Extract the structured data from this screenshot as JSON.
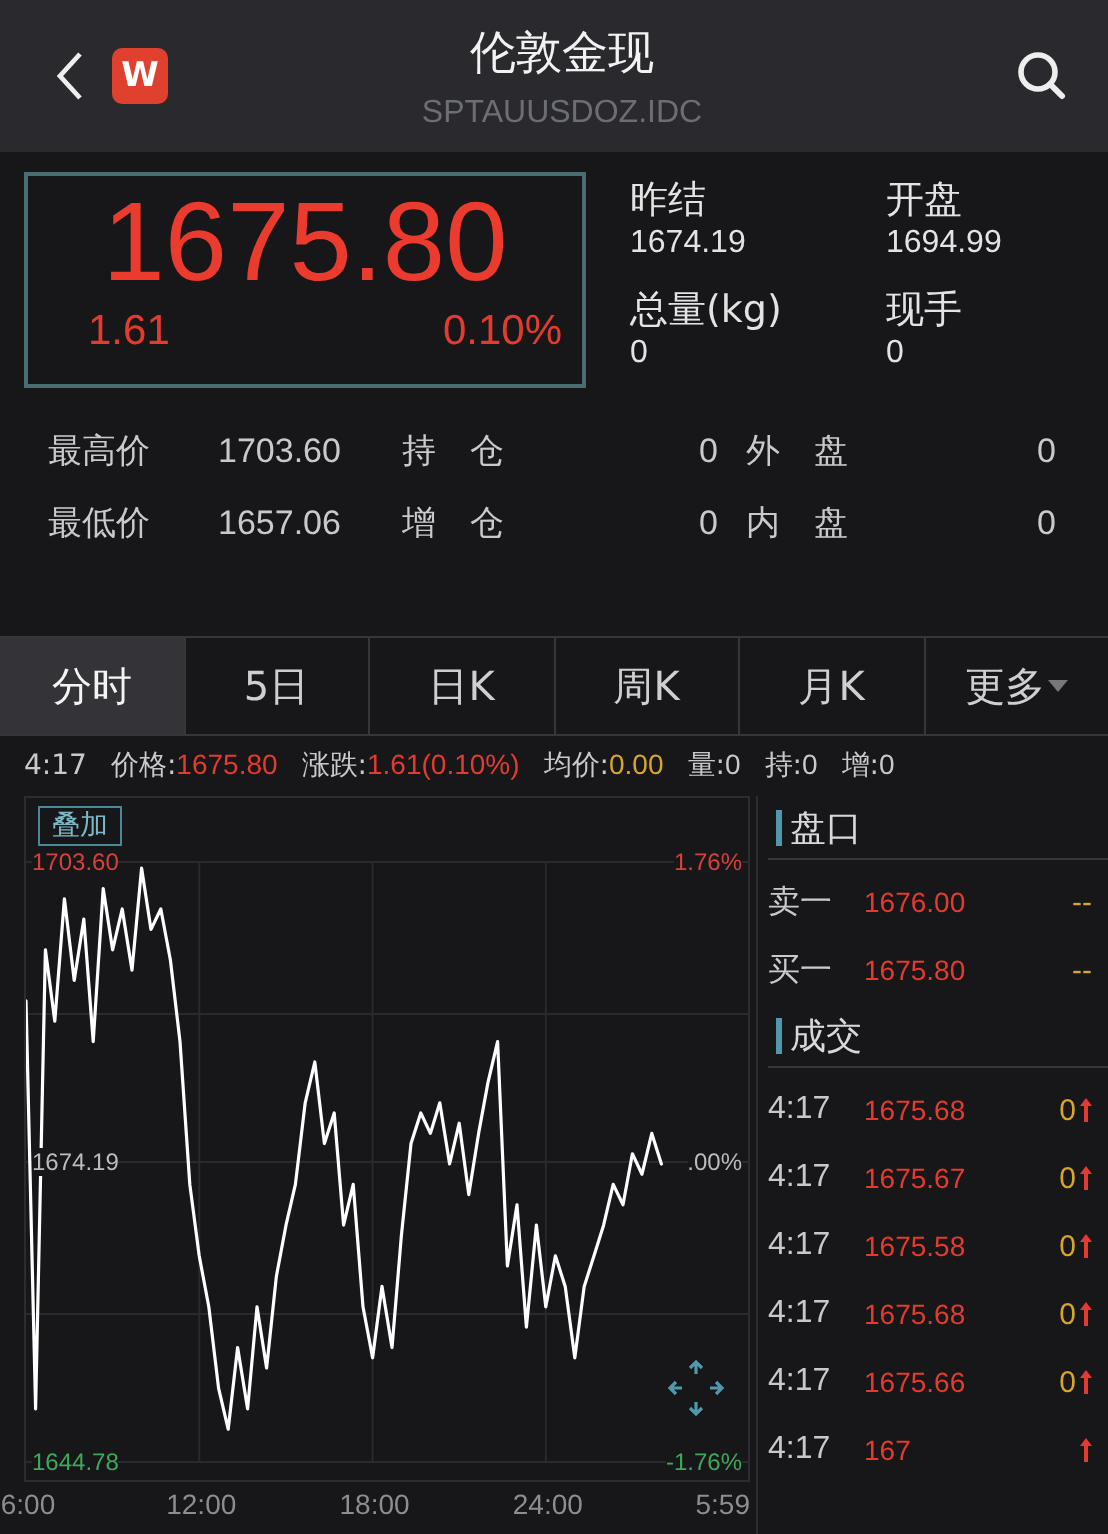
{
  "header": {
    "title": "伦敦金现",
    "subtitle": "SPTAUUSDOZ.IDC",
    "logo": "W"
  },
  "quote": {
    "price": "1675.80",
    "change": "1.61",
    "percent": "0.10%"
  },
  "summary": [
    {
      "label": "昨结",
      "value": "1674.19"
    },
    {
      "label": "开盘",
      "value": "1694.99"
    },
    {
      "label": "总量(kg)",
      "value": "0"
    },
    {
      "label": "现手",
      "value": "0"
    }
  ],
  "stats": [
    {
      "label": "最高价",
      "value": "1703.60",
      "label2": "持　仓",
      "value2": "0",
      "label3": "外　盘",
      "value3": "0"
    },
    {
      "label": "最低价",
      "value": "1657.06",
      "label2": "增　仓",
      "value2": "0",
      "label3": "内　盘",
      "value3": "0"
    }
  ],
  "tabs": [
    {
      "label": "分时",
      "selected": true,
      "dropdown": false
    },
    {
      "label": "5日",
      "selected": false,
      "dropdown": false
    },
    {
      "label": "日K",
      "selected": false,
      "dropdown": false
    },
    {
      "label": "周K",
      "selected": false,
      "dropdown": false
    },
    {
      "label": "月K",
      "selected": false,
      "dropdown": false
    },
    {
      "label": "更多",
      "selected": false,
      "dropdown": true
    }
  ],
  "info_line": [
    {
      "label": "4:17"
    },
    {
      "label": "价格:",
      "value": "1675.80",
      "color": "#e53b2f"
    },
    {
      "label": "涨跌:",
      "value": "1.61(0.10%)",
      "color": "#e53b2f"
    },
    {
      "label": "均价:",
      "value": "0.00",
      "color": "#d9a62a"
    },
    {
      "label": "量:",
      "value": "0",
      "color": "#c9c9cc"
    },
    {
      "label": "持:",
      "value": "0",
      "color": "#c9c9cc"
    },
    {
      "label": "增:",
      "value": "0",
      "color": "#c9c9cc"
    }
  ],
  "chart": {
    "overlay_button": "叠加",
    "high_pct": "1.76%",
    "mid_pct": ".00%",
    "low_pct": "-1.76%",
    "end_time": "5:59",
    "chart_data": {
      "type": "line",
      "x": [
        6,
        6.33,
        6.67,
        7,
        7.33,
        7.67,
        8,
        8.33,
        8.67,
        9,
        9.33,
        9.67,
        10,
        10.33,
        10.67,
        11,
        11.33,
        11.67,
        12,
        12.33,
        12.67,
        13,
        13.33,
        13.67,
        14,
        14.33,
        14.67,
        15,
        15.33,
        15.67,
        16,
        16.33,
        16.67,
        17,
        17.33,
        17.67,
        18,
        18.33,
        18.67,
        19,
        19.33,
        19.67,
        20,
        20.33,
        20.67,
        21,
        21.33,
        21.67,
        22,
        22.33,
        22.67,
        23,
        23.33,
        23.67,
        24,
        24.33,
        24.67,
        25,
        25.33,
        25.67,
        26,
        26.33,
        26.67,
        27,
        27.33,
        27.67,
        28
      ],
      "xlim": [
        6,
        31
      ],
      "grid": true,
      "ylim": [
        1644.78,
        1703.6
      ],
      "xticks": [
        {
          "value": 6,
          "label": "6:00"
        },
        {
          "value": 12,
          "label": "12:00"
        },
        {
          "value": 18,
          "label": "18:00"
        },
        {
          "value": 24,
          "label": "24:00"
        }
      ],
      "yticks": [
        {
          "value": 1644.78,
          "label": "1644.78"
        },
        {
          "value": 1674.19,
          "label": "1674.19"
        },
        {
          "value": 1703.6,
          "label": "1703.60"
        }
      ],
      "series": [
        {
          "color": "#ffffff",
          "values": [
            1690,
            1650,
            1695,
            1688,
            1700,
            1692,
            1698,
            1686,
            1701,
            1695,
            1699,
            1693,
            1703,
            1697,
            1699,
            1694,
            1686,
            1672,
            1665,
            1660,
            1652,
            1648,
            1656,
            1650,
            1660,
            1654,
            1663,
            1668,
            1672,
            1680,
            1684,
            1676,
            1679,
            1668,
            1672,
            1660,
            1655,
            1662,
            1656,
            1667,
            1676,
            1679,
            1677,
            1680,
            1674,
            1678,
            1671,
            1677,
            1682,
            1686,
            1664,
            1670,
            1658,
            1668,
            1660,
            1665,
            1662,
            1655,
            1662,
            1665,
            1668,
            1672,
            1670,
            1675,
            1673,
            1677,
            1674
          ]
        }
      ]
    }
  },
  "order_book": {
    "title": "盘口",
    "rows": [
      {
        "label": "卖一",
        "price": "1676.00",
        "volume": "--"
      },
      {
        "label": "买一",
        "price": "1675.80",
        "volume": "--"
      }
    ]
  },
  "trades": {
    "title": "成交",
    "rows": [
      {
        "time": "4:17",
        "price": "1675.68",
        "volume": "0"
      },
      {
        "time": "4:17",
        "price": "1675.67",
        "volume": "0"
      },
      {
        "time": "4:17",
        "price": "1675.58",
        "volume": "0"
      },
      {
        "time": "4:17",
        "price": "1675.68",
        "volume": "0"
      },
      {
        "time": "4:17",
        "price": "1675.66",
        "volume": "0"
      },
      {
        "time": "4:17",
        "price": "167"
      }
    ]
  }
}
